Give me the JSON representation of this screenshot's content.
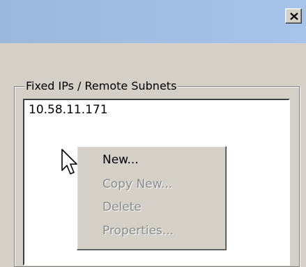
{
  "window": {
    "close_glyph": "×"
  },
  "groupbox": {
    "label": "Fixed IPs / Remote Subnets"
  },
  "list": {
    "items": [
      "10.58.11.171"
    ]
  },
  "context_menu": {
    "items": [
      {
        "label": "New...",
        "enabled": true
      },
      {
        "label": "Copy New...",
        "enabled": false
      },
      {
        "label": "Delete",
        "enabled": false
      },
      {
        "label": "Properties...",
        "enabled": false
      }
    ]
  },
  "colors": {
    "dialog_face": "#d4d0c8",
    "titlebar_start": "#9bb8dc",
    "titlebar_end": "#a6c4ea",
    "disabled_text": "#8a8a8a"
  },
  "icons": {
    "close": "close-icon",
    "pointer": "mouse-pointer-icon"
  }
}
